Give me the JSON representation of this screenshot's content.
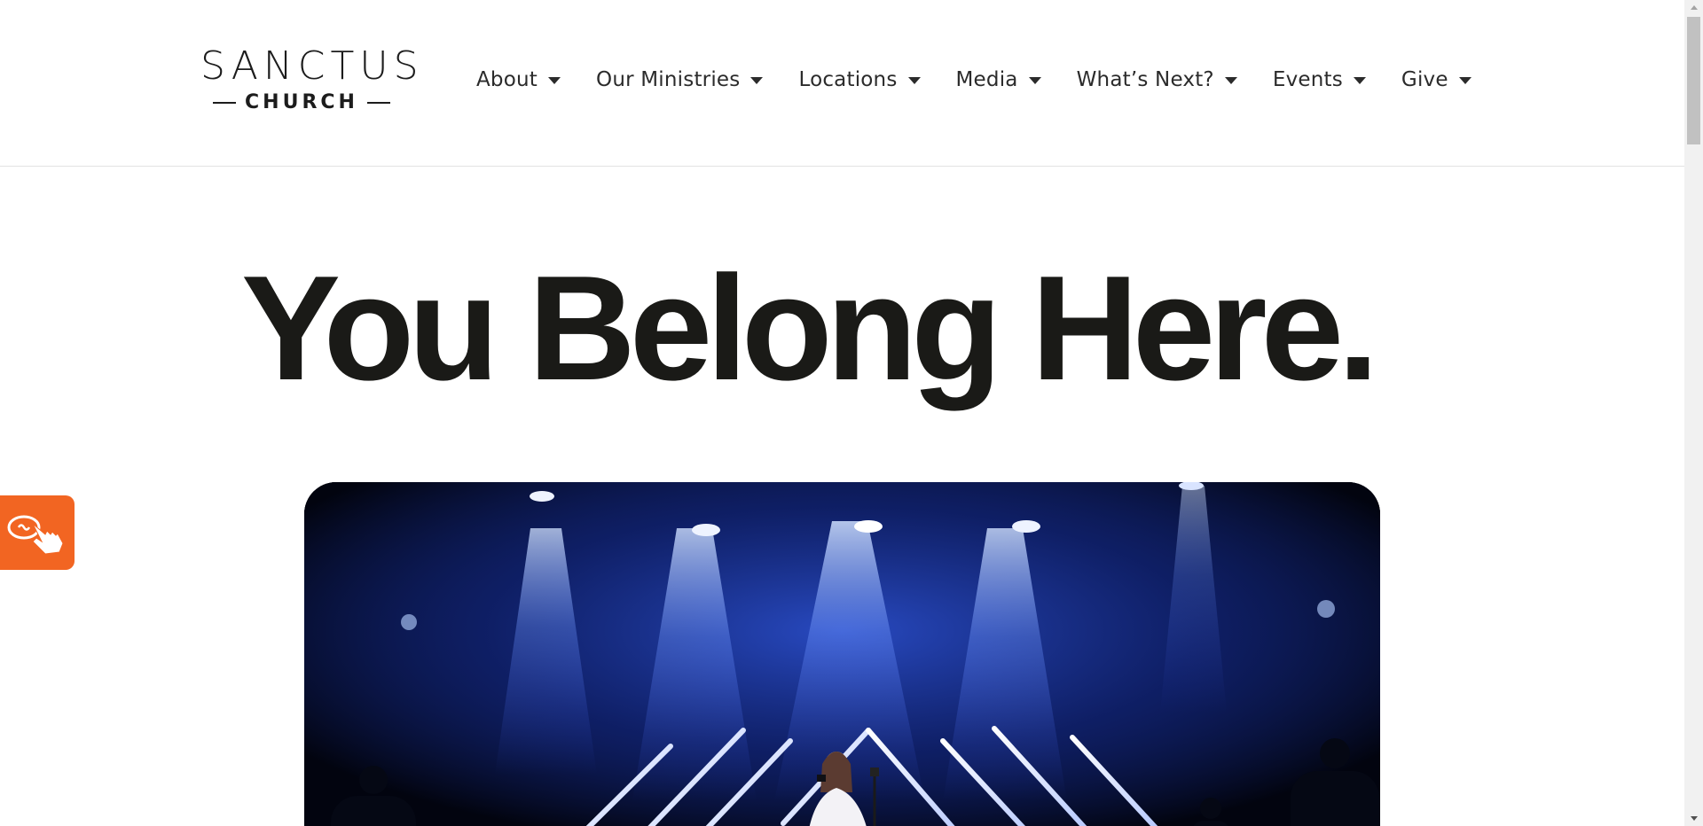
{
  "logo": {
    "main": "SANCTUS",
    "sub": "CHURCH"
  },
  "nav": {
    "items": [
      {
        "label": "About"
      },
      {
        "label": "Our Ministries"
      },
      {
        "label": "Locations"
      },
      {
        "label": "Media"
      },
      {
        "label": "What’s Next?"
      },
      {
        "label": "Events"
      },
      {
        "label": "Give"
      }
    ]
  },
  "hero": {
    "title": "You Belong Here."
  },
  "colors": {
    "accent_orange": "#f26522",
    "text_dark": "#1a1a17",
    "hero_blue": "#1b3fd1"
  },
  "icons": {
    "nav_caret": "caret-down-icon",
    "accessibility": "accessibility-hand-icon"
  }
}
